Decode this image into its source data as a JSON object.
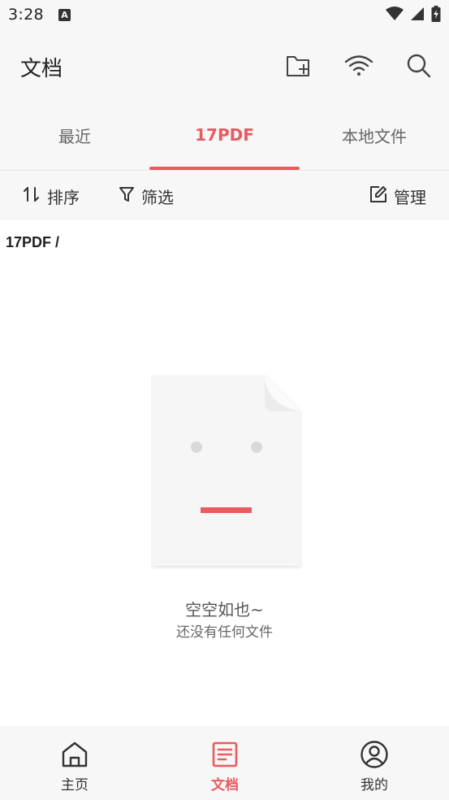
{
  "status_bar": {
    "time": "3:28",
    "notification_icon": "a-badge-icon"
  },
  "header": {
    "title": "文档",
    "actions": [
      "new-folder-icon",
      "wifi-transfer-icon",
      "search-icon"
    ]
  },
  "tabs": {
    "items": [
      {
        "label": "最近"
      },
      {
        "label": "17PDF"
      },
      {
        "label": "本地文件"
      }
    ],
    "active_index": 1
  },
  "toolbar": {
    "sort_label": "排序",
    "filter_label": "筛选",
    "manage_label": "管理"
  },
  "breadcrumb": "17PDF /",
  "empty_state": {
    "title": "空空如也~",
    "subtitle": "还没有任何文件"
  },
  "bottom_nav": {
    "items": [
      {
        "label": "主页",
        "icon": "home-icon"
      },
      {
        "label": "文档",
        "icon": "document-icon"
      },
      {
        "label": "我的",
        "icon": "profile-icon"
      }
    ],
    "active_index": 1
  },
  "colors": {
    "accent": "#ea5a5f",
    "background": "#f7f7f7",
    "text": "#222222"
  }
}
